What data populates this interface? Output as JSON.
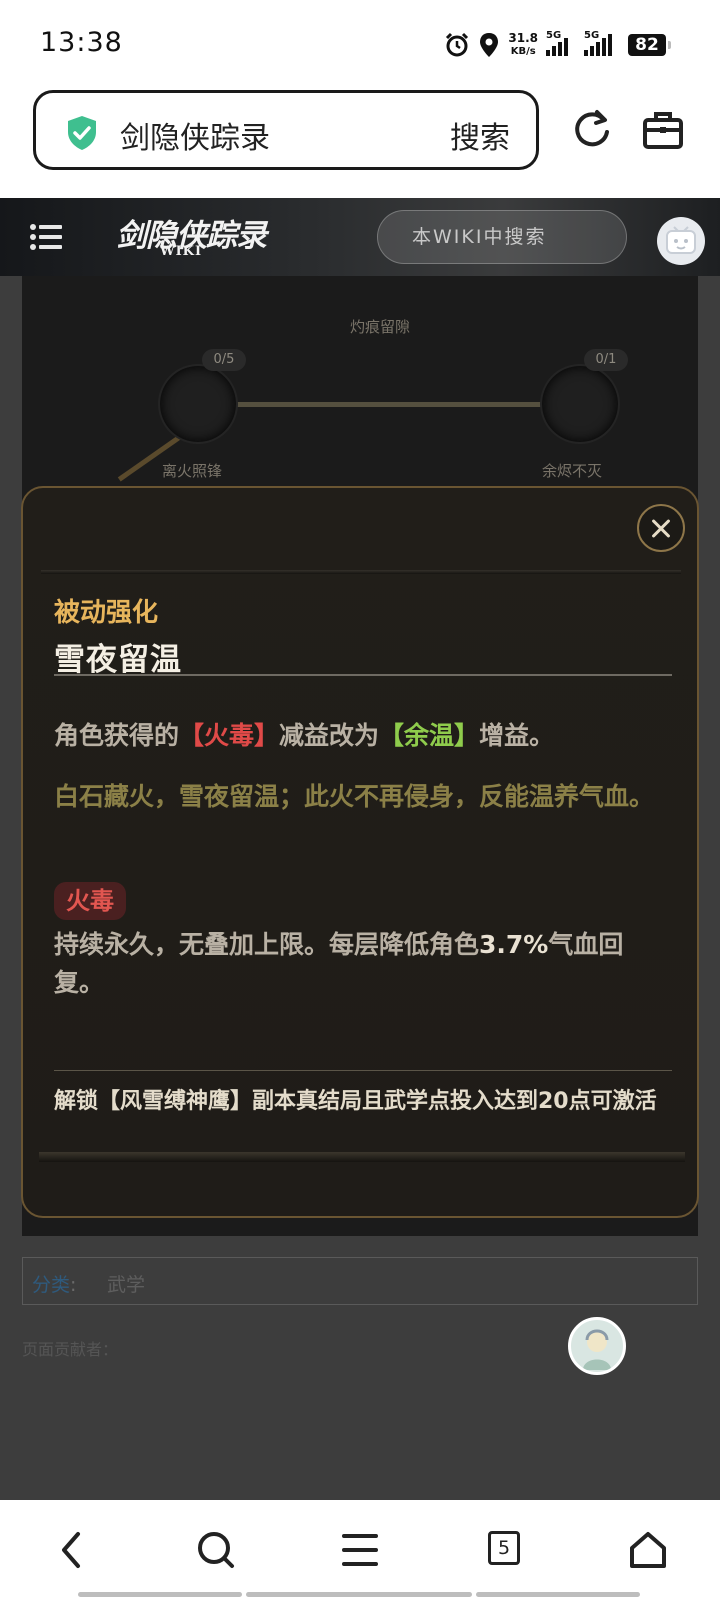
{
  "status_bar": {
    "time": "13:38",
    "net_speed_value": "31.8",
    "net_speed_unit": "KB/s",
    "sim1": "5G",
    "sim2": "5G",
    "battery": "82"
  },
  "address_bar": {
    "title": "剑隐侠踪录",
    "search_label": "搜索"
  },
  "wiki_header": {
    "logo_main": "剑隐侠踪录",
    "logo_sub": "WIKI",
    "search_placeholder": "本WIKI中搜索"
  },
  "skill_tree": {
    "top_node_label": "灼痕留隙",
    "left_node_count": "0/5",
    "right_node_count": "0/1",
    "left_node_label": "离火照锋",
    "right_node_label": "余烬不灭"
  },
  "modal": {
    "category": "被动强化",
    "title": "雪夜留温",
    "desc_prefix": "角色获得的",
    "desc_debuff": "【火毒】",
    "desc_mid": "减益改为",
    "desc_buff": "【余温】",
    "desc_suffix": "增益。",
    "flavor": "白石藏火，雪夜留温；此火不再侵身，反能温养气血。",
    "tag_name": "火毒",
    "tag_desc_prefix": "持续永久，无叠加上限。每层降低角色",
    "tag_desc_value": "3.7%",
    "tag_desc_suffix": "气血回复。",
    "unlock": "解锁【风雪缚神鹰】副本真结局且武学点投入达到20点可激活"
  },
  "page": {
    "category_label": "分类",
    "category_value": "武学",
    "contributors_label": "页面贡献者："
  },
  "bottom_nav": {
    "tab_count": "5"
  },
  "colors": {
    "accent_gold": "#e7b55c",
    "debuff_red": "#e04a48",
    "buff_green": "#8fcc4c",
    "modal_bg": "#211e19",
    "shield_green": "#3fbf8f"
  }
}
